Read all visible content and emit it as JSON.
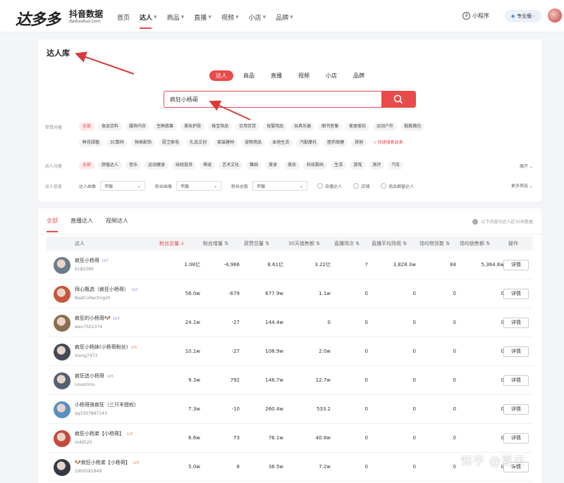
{
  "topbar": {
    "logo": "达多多",
    "logo_sub": "抖音数据",
    "logo_url": "daduoduo.com",
    "nav": [
      "首页",
      "达人",
      "商品",
      "直播",
      "视频",
      "小店",
      "品牌"
    ],
    "active_nav": "达人",
    "mini_program": "小程序",
    "pro_label": "专业版"
  },
  "page": {
    "title": "达人库",
    "search_tabs": [
      "达人",
      "商品",
      "直播",
      "视频",
      "小店",
      "品牌"
    ],
    "search_value": "疯狂小杨哥",
    "filters": {
      "category_label": "带货分类",
      "category_row1": [
        "全部",
        "食品饮料",
        "服饰内衣",
        "生鲜蔬果",
        "美妆护肤",
        "珠宝饰品",
        "日用百货",
        "母婴用品",
        "玩具乐器",
        "图书音像",
        "家居家纺",
        "运动户外",
        "鞋靴箱包"
      ],
      "category_row2": [
        "鲜花绿植",
        "3C数码",
        "钟表配饰",
        "厨卫家电",
        "礼品文创",
        "家装建材",
        "宠物用品",
        "本地生活",
        "汽配摩托",
        "医药保健",
        "其他"
      ],
      "category_link": "快速搜索品类",
      "talent_label": "达人分类",
      "talent_tags": [
        "全部",
        "颜值达人",
        "音乐",
        "运动健身",
        "财经投资",
        "萌宠",
        "艺术文化",
        "舞蹈",
        "美食",
        "美妆",
        "科技数码",
        "生活",
        "游戏",
        "测评",
        "汽车"
      ],
      "expand": "展开",
      "info_label": "达人信息",
      "portrait_label": "达人画像",
      "fans_portrait_label": "粉丝画像",
      "fans_total_label": "粉丝总数",
      "unlimited": "不限",
      "chk_self": "自播达人",
      "chk_store": "店铺",
      "chk_sales": "商品橱窗达人",
      "more": "更多筛选"
    }
  },
  "results": {
    "tabs": [
      "全部",
      "直播达人",
      "视频达人"
    ],
    "note": "以下内容为达人近30天数据",
    "columns": [
      "达人",
      "粉丝总量",
      "粉丝增量",
      "获赞总量",
      "30天销售额",
      "直播场次",
      "直播平均场观",
      "场均带货数",
      "场均销售额",
      "操作"
    ],
    "detail_label": "详情",
    "rows": [
      {
        "name": "疯狂小杨哥",
        "level": "LV7",
        "id": "6182390",
        "fans": "1.08亿",
        "inc": "-4,966",
        "likes": "8.61亿",
        "sales": "3.22亿",
        "lives": "7",
        "avg": "3,828.3w",
        "goods": "84",
        "avg_sales": "5,364.8w"
      },
      {
        "name": "拜心甄选（疯狂小杨哥）",
        "level": "LV1",
        "id": "BestCollecting20",
        "fans": "56.0w",
        "inc": "-679",
        "likes": "677.9w",
        "sales": "1.1w",
        "lives": "0",
        "avg": "0",
        "goods": "0",
        "avg_sales": "0"
      },
      {
        "name": "疯狂的小杨哥🐶",
        "level": "LV3",
        "id": "wan7501374",
        "fans": "24.1w",
        "inc": "-27",
        "likes": "144.4w",
        "sales": "0",
        "lives": "0",
        "avg": "0",
        "goods": "0",
        "avg_sales": "0"
      },
      {
        "name": "疯狂小杨妹(小杨哥粉丝)",
        "level": "LV5",
        "id": "Xiong7473",
        "fans": "10.1w",
        "inc": "-27",
        "likes": "108.9w",
        "sales": "2.0w",
        "lives": "0",
        "avg": "0",
        "goods": "0",
        "avg_sales": "0"
      },
      {
        "name": "疯狂追小杨哥",
        "level": "LV3",
        "id": "Lovezimu",
        "fans": "9.3w",
        "inc": "792",
        "likes": "146.7w",
        "sales": "12.7w",
        "lives": "0",
        "avg": "0",
        "goods": "0",
        "avg_sales": "0"
      },
      {
        "name": "小杨哥很疯狂（三只羊授权）",
        "level": "",
        "id": "qq1007897143",
        "fans": "7.3w",
        "inc": "-10",
        "likes": "260.4w",
        "sales": "533.2",
        "lives": "0",
        "avg": "0",
        "goods": "0",
        "avg_sales": "0"
      },
      {
        "name": "疯狂小杨弟【小杨哥】",
        "level": "LV5",
        "id": "iodd520",
        "fans": "6.6w",
        "inc": "73",
        "likes": "76.1w",
        "sales": "40.8w",
        "lives": "0",
        "avg": "0",
        "goods": "0",
        "avg_sales": "0"
      },
      {
        "name": "🐶疯狂小杨弟【小杨哥】",
        "level": "LV5",
        "id": "1900581849",
        "fans": "5.0w",
        "inc": "8",
        "likes": "38.5w",
        "sales": "7.2w",
        "lives": "0",
        "avg": "0",
        "goods": "0",
        "avg_sales": "0"
      }
    ]
  },
  "watermark": "知乎 @夏天",
  "colors": {
    "accent": "#e84b4b",
    "arrow": "#d93a3a"
  }
}
